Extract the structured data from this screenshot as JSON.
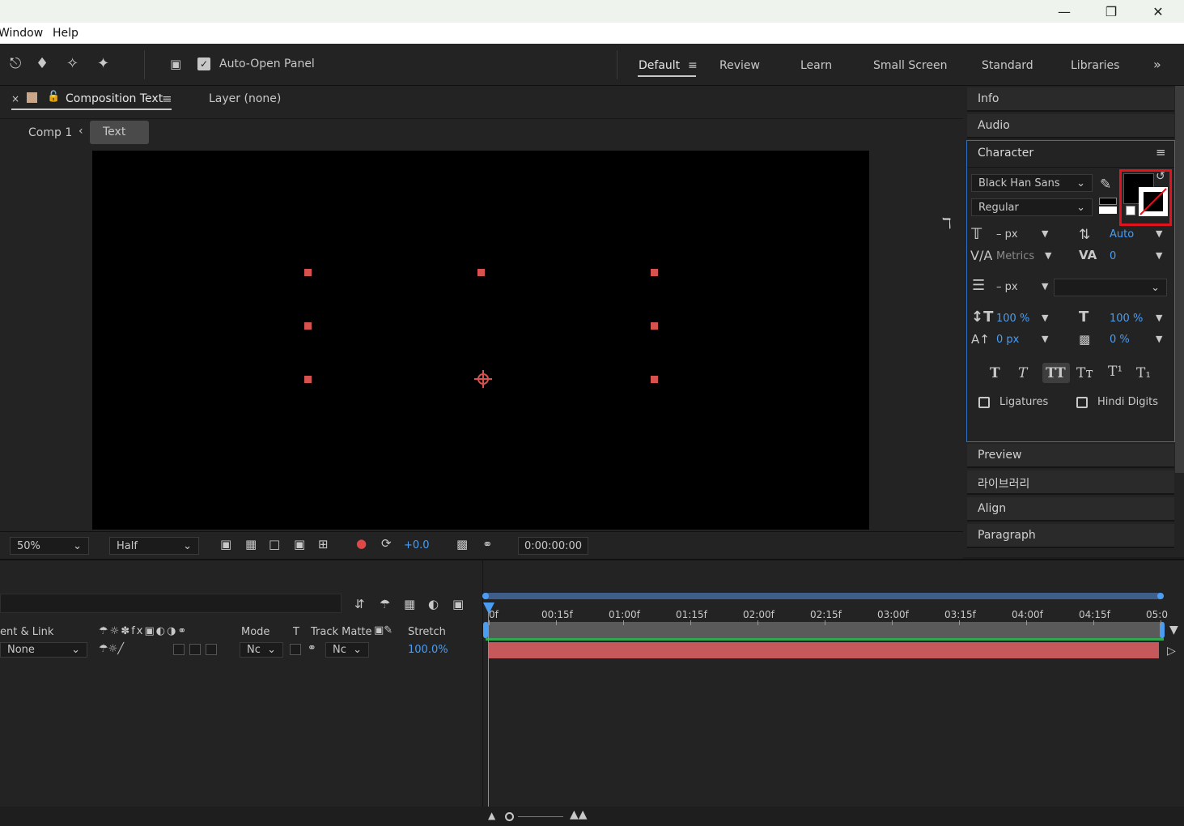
{
  "menu": {
    "window": "Window",
    "help": "Help"
  },
  "toolbar": {
    "auto_open_panel": "Auto-Open Panel"
  },
  "workspaces": [
    "Default",
    "Review",
    "Learn",
    "Small Screen",
    "Standard",
    "Libraries"
  ],
  "comp_panel": {
    "tab_title": "Composition Text",
    "layer_tab": "Layer (none)",
    "breadcrumb_parent": "Comp 1",
    "breadcrumb_current": "Text"
  },
  "viewer_bar": {
    "zoom": "50%",
    "resolution": "Half",
    "exposure": "+0.0",
    "timecode": "0:00:00:00"
  },
  "right_panels": {
    "info": "Info",
    "audio": "Audio",
    "character": "Character",
    "preview": "Preview",
    "libraries_kr": "라이브러리",
    "align": "Align",
    "paragraph": "Paragraph"
  },
  "character": {
    "font_family": "Black Han Sans",
    "font_style": "Regular",
    "font_size": "– px",
    "leading": "Auto",
    "kerning": "Metrics",
    "tracking": "0",
    "stroke_width": "– px",
    "vert_scale": "100 %",
    "horiz_scale": "100 %",
    "baseline_shift": "0 px",
    "tsume": "0 %",
    "ligatures": "Ligatures",
    "hindi_digits": "Hindi Digits"
  },
  "timeline": {
    "col_parent": "ent & Link",
    "col_mode": "Mode",
    "col_t": "T",
    "col_track_matte": "Track Matte",
    "col_stretch": "Stretch",
    "parent_value": "None",
    "mode_value": "Nc",
    "matte_value": "Nc",
    "stretch_value": "100.0%",
    "ruler": [
      "0f",
      "00:15f",
      "01:00f",
      "01:15f",
      "02:00f",
      "02:15f",
      "03:00f",
      "03:15f",
      "04:00f",
      "04:15f",
      "05:0"
    ]
  },
  "colors": {
    "accent_blue": "#4b9df2",
    "layer_bar": "#c4585a",
    "handle": "#d6524e",
    "highlight_red": "#e0141e"
  }
}
